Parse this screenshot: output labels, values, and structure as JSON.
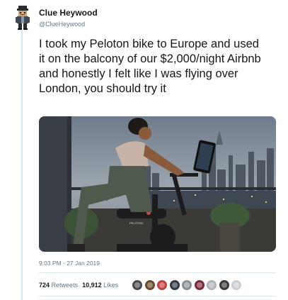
{
  "tweet": {
    "author_name": "Clue Heywood",
    "author_handle": "@ClueHeywood",
    "text": "I took my Peloton bike to Europe and used it on the balcony of our $2,000/night Airbnb and honestly I felt like I was flying over London, you should try it",
    "timestamp": "9:03 PM - 27 Jan 2019",
    "media_alt": "Woman riding a Peloton bike on a balcony overlooking a city skyline at dusk"
  },
  "stats": {
    "retweets_count": "724",
    "retweets_label": "Retweets",
    "likes_count": "10,912",
    "likes_label": "Likes"
  },
  "likers": [
    {
      "name": "liker-1",
      "color": "#4a4a4a"
    },
    {
      "name": "liker-2",
      "color": "#6b4b2a"
    },
    {
      "name": "liker-3",
      "color": "#c04040"
    },
    {
      "name": "liker-4",
      "color": "#2f3a45"
    },
    {
      "name": "liker-5",
      "color": "#8a8f94"
    },
    {
      "name": "liker-6",
      "color": "#7a2a3a"
    },
    {
      "name": "liker-7",
      "color": "#b0b4b8"
    },
    {
      "name": "liker-8",
      "color": "#3b3b3b"
    },
    {
      "name": "liker-9",
      "color": "#c8ced3"
    }
  ],
  "colors": {
    "thread_line": "#dbe6ef",
    "secondary_text": "#657786",
    "primary_text": "#14171a"
  }
}
